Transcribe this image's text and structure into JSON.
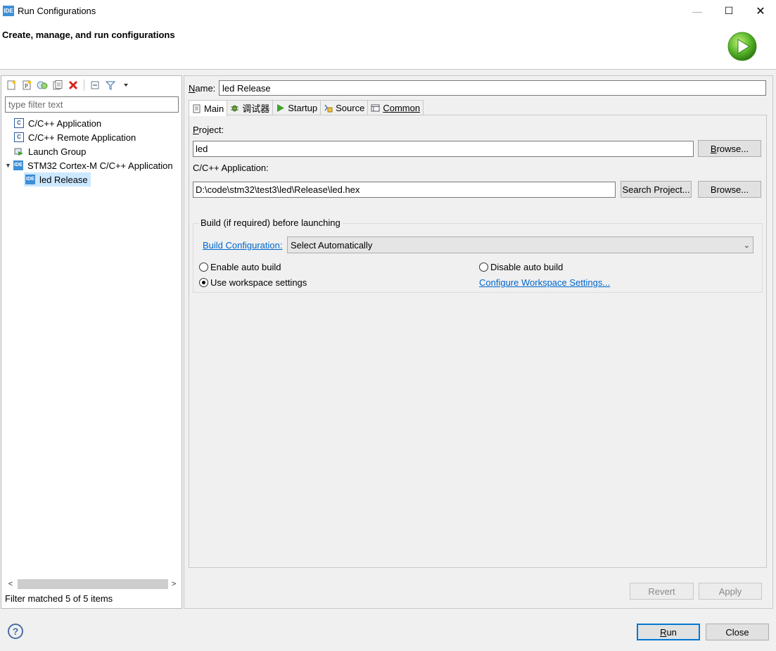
{
  "window": {
    "icon_text": "IDE",
    "title": "Run Configurations",
    "minimize": "—",
    "maximize": "☐",
    "close": "✕"
  },
  "header": {
    "title": "Create, manage, and run configurations",
    "logo_icon": "run-play-icon"
  },
  "left": {
    "toolbar_icons": [
      "new-config-icon",
      "new-prototype-icon",
      "duplicate-icon",
      "export-icon",
      "delete-icon",
      "collapse-all-icon",
      "filter-icon",
      "dropdown-arrow-icon"
    ],
    "filter_placeholder": "type filter text",
    "tree": [
      {
        "label": "C/C++ Application",
        "icon": "c-app-icon",
        "icon_text": "C"
      },
      {
        "label": "C/C++ Remote Application",
        "icon": "c-remote-icon",
        "icon_text": "C"
      },
      {
        "label": "Launch Group",
        "icon": "launch-group-icon"
      },
      {
        "label": "STM32 Cortex-M C/C++ Application",
        "icon": "ide-icon",
        "icon_text": "IDE"
      },
      {
        "label": "led Release",
        "icon": "ide-icon",
        "icon_text": "IDE"
      }
    ],
    "scroll_left": "<",
    "scroll_right": ">",
    "status": "Filter matched 5 of 5 items"
  },
  "right": {
    "name_label_first": "N",
    "name_label_rest": "ame:",
    "name_value": "led Release",
    "tabs": [
      {
        "label": "Main",
        "icon": "main-tab-icon"
      },
      {
        "label": "调试器",
        "icon": "debugger-tab-icon"
      },
      {
        "label": "Startup",
        "icon": "startup-tab-icon"
      },
      {
        "label": "Source",
        "icon": "source-tab-icon"
      },
      {
        "label": "Common",
        "icon": "common-tab-icon"
      }
    ],
    "project_label_first": "P",
    "project_label_rest": "roject:",
    "project_value": "led",
    "browse1_first": "B",
    "browse1_rest": "rowse...",
    "app_label": "C/C++ Application:",
    "app_value": "D:\\code\\stm32\\test3\\led\\Release\\led.hex",
    "search_project": "Search Project...",
    "browse2": "Browse...",
    "build_group_title": "Build (if required) before launching",
    "build_config_link": "Build Configuration:",
    "build_config_value": "Select Automatically",
    "enable_auto_build": "Enable auto build",
    "disable_auto_build": "Disable auto build",
    "use_workspace": "Use workspace settings",
    "configure_workspace": "Configure Workspace Settings...",
    "revert": "Revert",
    "apply": "Apply"
  },
  "footer": {
    "help": "?",
    "run_first": "R",
    "run_rest": "un",
    "close": "Close"
  }
}
